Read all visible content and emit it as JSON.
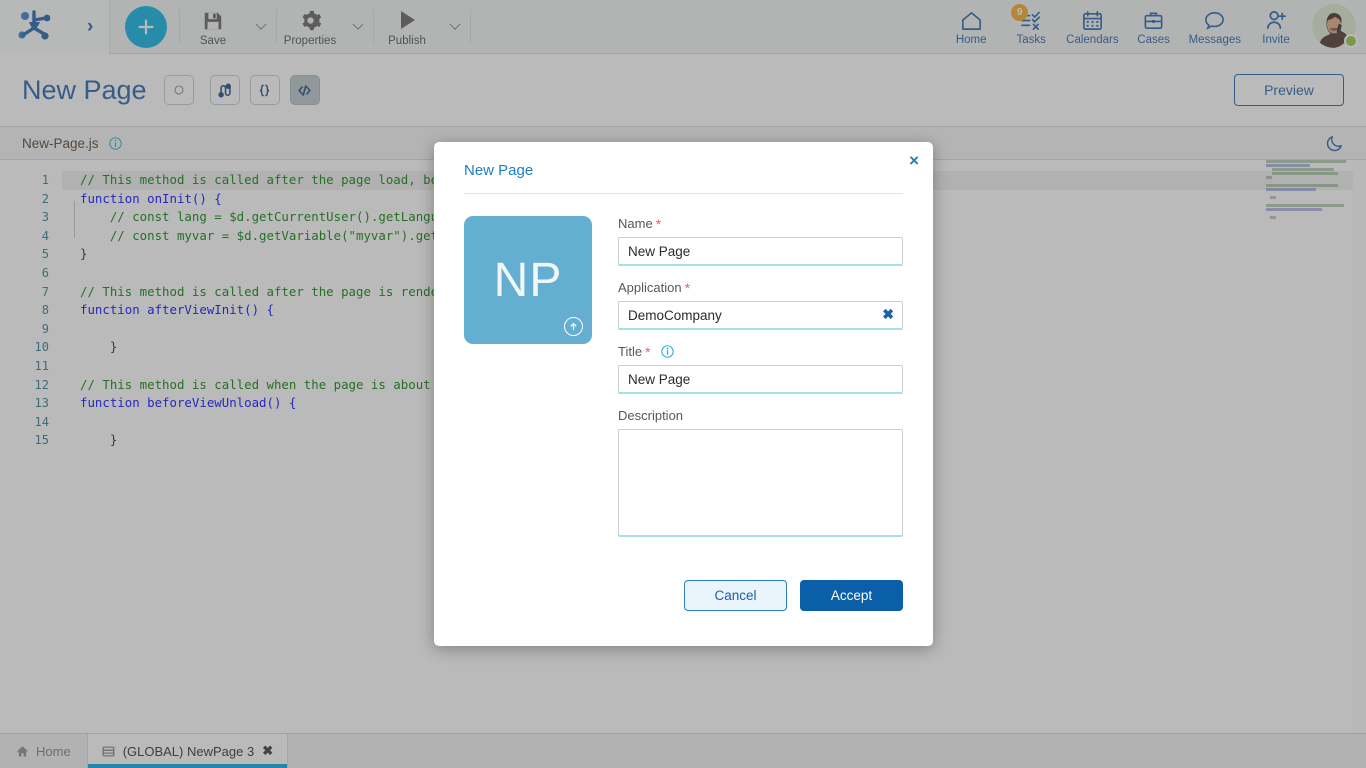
{
  "toolbar": {
    "add_label": "+",
    "items": [
      {
        "label": "Save",
        "icon": "save-icon"
      },
      {
        "label": "Properties",
        "icon": "gear-icon"
      },
      {
        "label": "Publish",
        "icon": "play-icon"
      }
    ],
    "nav": [
      {
        "label": "Home",
        "icon": "house-icon",
        "badge": ""
      },
      {
        "label": "Tasks",
        "icon": "tasks-icon",
        "badge": "9"
      },
      {
        "label": "Calendars",
        "icon": "calendar-icon",
        "badge": ""
      },
      {
        "label": "Cases",
        "icon": "briefcase-icon",
        "badge": ""
      },
      {
        "label": "Messages",
        "icon": "chat-bubble-icon",
        "badge": ""
      },
      {
        "label": "Invite",
        "icon": "person-plus-icon",
        "badge": ""
      }
    ]
  },
  "page_header": {
    "title": "New Page",
    "buttons": [
      {
        "name": "circle",
        "glyph": "circle-icon",
        "active": false
      },
      {
        "name": "flow",
        "glyph": "flow-icon",
        "active": false
      },
      {
        "name": "braces",
        "glyph": "braces-icon",
        "active": false
      },
      {
        "name": "code",
        "glyph": "code-icon",
        "active": true
      }
    ],
    "preview_label": "Preview"
  },
  "editor": {
    "file_name": "New-Page.js",
    "line_numbers": [
      "1",
      "2",
      "3",
      "4",
      "5",
      "6",
      "7",
      "8",
      "9",
      "10",
      "11",
      "12",
      "13",
      "14",
      "15"
    ],
    "lines": [
      "// This method is called after the page load, befo",
      "function onInit() {",
      "    // const lang = $d.getCurrentUser().getLanguag",
      "    // const myvar = $d.getVariable(\"myvar\").getVa",
      "}",
      "",
      "// This method is called after the page is rendere",
      "function afterViewInit() {",
      "",
      "    }",
      "",
      "// This method is called when the page is about to",
      "function beforeViewUnload() {",
      "",
      "    }"
    ]
  },
  "modal": {
    "title": "New Page",
    "close_label": "×",
    "tile_initials": "NP",
    "name": {
      "label": "Name",
      "required": true,
      "value": "New Page"
    },
    "application": {
      "label": "Application",
      "required": true,
      "value": "DemoCompany",
      "clear_label": "✖"
    },
    "title_field": {
      "label": "Title",
      "required": true,
      "value": "New Page",
      "has_info": true
    },
    "description": {
      "label": "Description",
      "required": false,
      "value": "",
      "placeholder": ""
    },
    "cancel_label": "Cancel",
    "accept_label": "Accept"
  },
  "taskbar": {
    "home_label": "Home",
    "tab_label": "(GLOBAL) NewPage 3",
    "tab_close": "✖"
  },
  "colors": {
    "accent_blue": "#1b5faa",
    "cyan": "#00b0e4",
    "badge_orange": "#f4a81d",
    "tile_blue": "#64aed1",
    "accept_blue": "#0b5ea8",
    "status_green": "#8cc63e",
    "required_red": "#f25c5c",
    "comment_green": "#008000",
    "keyword_blue": "#0000ff"
  }
}
